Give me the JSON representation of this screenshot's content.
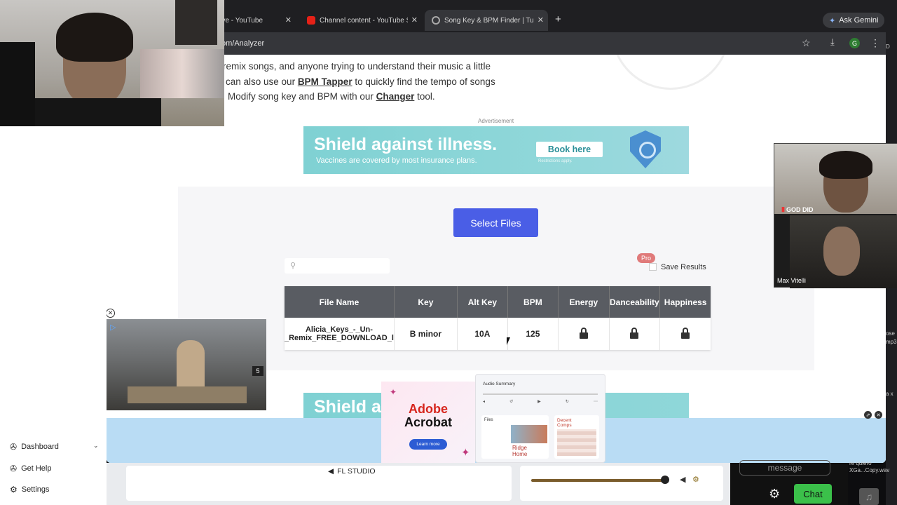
{
  "browser": {
    "tabs": [
      {
        "title": "live - YouTube",
        "favicon": "youtube-icon"
      },
      {
        "title": "Channel content - YouTube S",
        "favicon": "youtube-icon"
      },
      {
        "title": "Song Key & BPM Finder | Tun",
        "favicon": "tunebat-icon",
        "active": true
      }
    ],
    "new_tab": "+",
    "gemini": "Ask Gemini",
    "url": "om/Analyzer",
    "avatar_letter": "G"
  },
  "page": {
    "intro": {
      "line1": "remix songs, and anyone trying to understand their music a little",
      "line2_pre": "can also use our ",
      "bpm_tapper": "BPM Tapper",
      "line2_post": " to quickly find the tempo of songs",
      "line3_pre": "Modify song key and BPM with our ",
      "changer": "Changer",
      "line3_post": " tool."
    },
    "ad_label": "Advertisement",
    "ad": {
      "headline": "Shield against illness.",
      "sub": "Vaccines are covered by most insurance plans.",
      "button": "Book here",
      "small": "Restrictions apply."
    },
    "ad2_headline": "Shield a",
    "select_files": "Select Files",
    "pro_badge": "Pro",
    "save_results": "Save Results",
    "table": {
      "headers": [
        "File Name",
        "Key",
        "Alt Key",
        "BPM",
        "Energy",
        "Danceability",
        "Happiness"
      ],
      "row": {
        "file_line1": "Alicia_Keys_-_Un-",
        "file_line2": "_Remix_FREE_DOWNLOAD_l",
        "key": "B minor",
        "alt_key": "10A",
        "bpm": "125"
      }
    },
    "acrobat": {
      "title1": "Adobe",
      "title2": "Acrobat",
      "button": "Learn more"
    },
    "audio_card": {
      "title": "Audio Summary",
      "files": "Files",
      "ridge1": "Ridge",
      "ridge2": "Home",
      "comps1": "Decent",
      "comps2": "Comps"
    }
  },
  "video_overlay": {
    "count": "5"
  },
  "sidebar": {
    "items": [
      {
        "label": "Dashboard"
      },
      {
        "label": "Get Help"
      },
      {
        "label": "Settings"
      }
    ]
  },
  "bottom_strip": {
    "fl_studio": "FL STUDIO"
  },
  "call": {
    "name_top": "GOD DID",
    "name_bottom": "Max Vitelli"
  },
  "chat": {
    "placeholder": "message",
    "button": "Chat"
  },
  "right_crop": {
    "a": "ose",
    "b": "mp3",
    "c": "a x",
    "d": "re quiero",
    "e": "XGa...Copy.wav",
    "f": "D"
  }
}
